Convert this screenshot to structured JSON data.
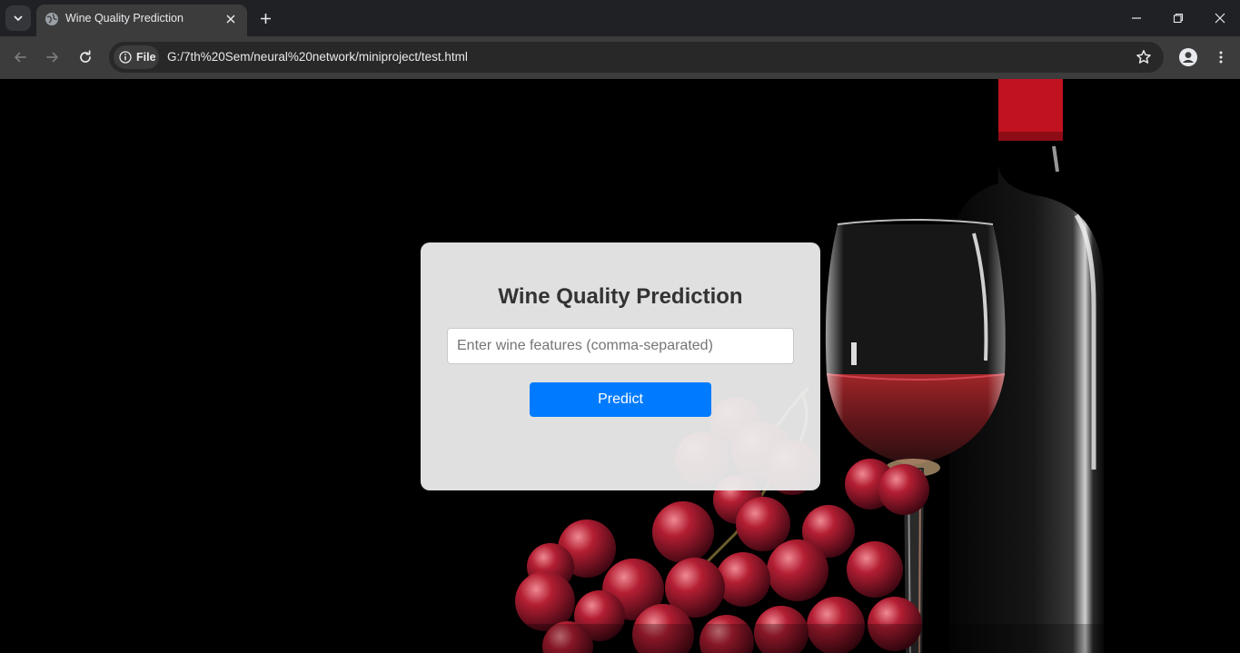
{
  "browser": {
    "tab": {
      "title": "Wine Quality Prediction"
    },
    "address_bar": {
      "security_chip": "File",
      "url": "G:/7th%20Sem/neural%20network/miniproject/test.html"
    }
  },
  "page": {
    "title": "Wine Quality Prediction",
    "features_input": {
      "value": "",
      "placeholder": "Enter wine features (comma-separated)"
    },
    "predict_button": "Predict"
  },
  "colors": {
    "accent": "#007bff",
    "card_background": "#ececec",
    "page_background": "#000000",
    "wine_cap": "#c1121f"
  }
}
